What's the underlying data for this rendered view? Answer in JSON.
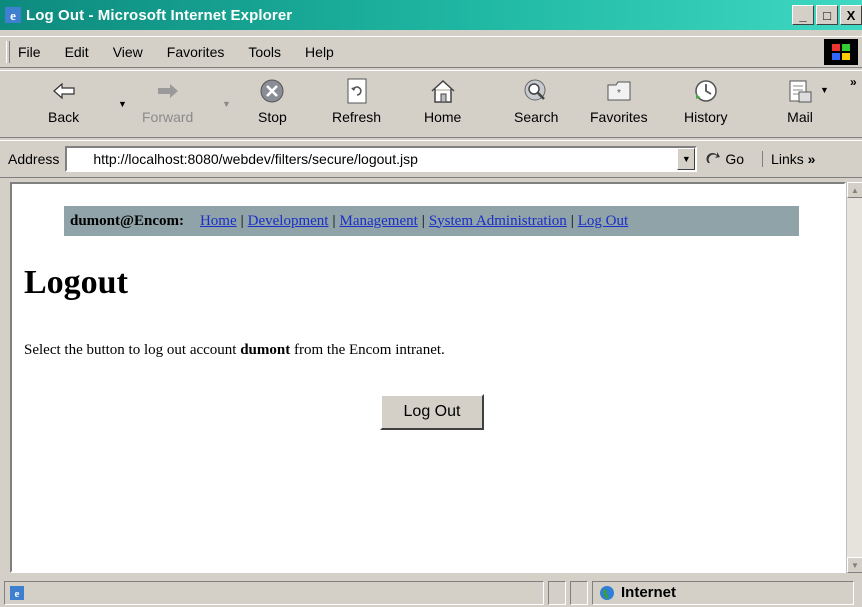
{
  "window": {
    "title": "Log Out - Microsoft Internet Explorer",
    "minimize": "_",
    "maximize": "□",
    "close": "X"
  },
  "menu": {
    "items": [
      "File",
      "Edit",
      "View",
      "Favorites",
      "Tools",
      "Help"
    ]
  },
  "toolbar": {
    "back": "Back",
    "forward": "Forward",
    "stop": "Stop",
    "refresh": "Refresh",
    "home": "Home",
    "search": "Search",
    "favorites": "Favorites",
    "history": "History",
    "mail": "Mail"
  },
  "address": {
    "label": "Address",
    "url": "http://localhost:8080/webdev/filters/secure/logout.jsp",
    "go": "Go",
    "links": "Links"
  },
  "page": {
    "nav": {
      "user": "dumont@Encom:",
      "links": [
        "Home",
        "Development",
        "Management",
        "System Administration",
        "Log Out"
      ]
    },
    "title": "Logout",
    "text_before": "Select the button to log out account ",
    "account": "dumont",
    "text_after": " from the Encom intranet.",
    "button": "Log Out"
  },
  "status": {
    "zone": "Internet"
  },
  "colors": {
    "titlebar": "#1fb8a3",
    "nav_bg": "#8fa3a8",
    "link": "#1a2ec8"
  }
}
